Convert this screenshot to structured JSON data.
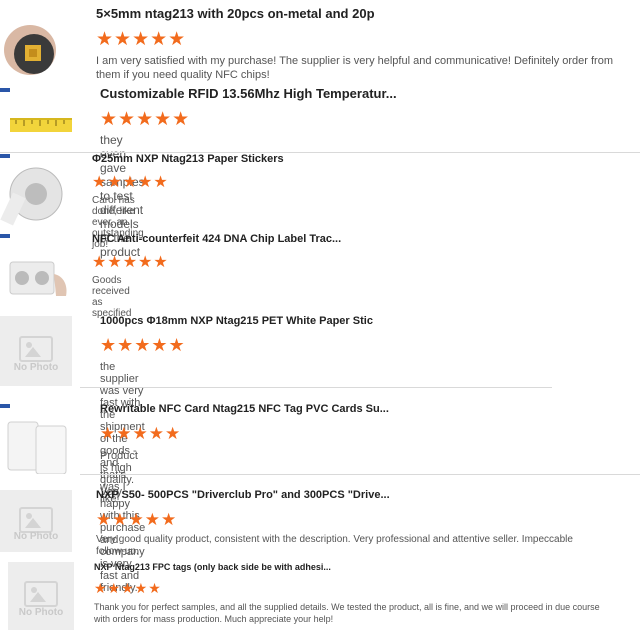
{
  "stars_glyph": "★★★★★",
  "accent_color": "#f26b1d",
  "no_photo_label": "No Photo",
  "items": [
    {
      "title": "5×5mm ntag213 with 20pcs on-metal and 20p",
      "review": "I am very satisfied with my purchase! The supplier is very helpful and communicative! Definitely order from them if you need quality NFC chips!",
      "rating": 5
    },
    {
      "title": "Customizable RFID 13.56Mhz High Temperatur...",
      "review": "they even gave samples to test different models of the product",
      "rating": 5
    },
    {
      "title": "Φ25mm NXP Ntag213 Paper Stickers",
      "review": "Carol has done, like ever,  an outstanding job!",
      "rating": 5
    },
    {
      "title": "NFC Anti-counterfeit 424 DNA Chip Label Trac...",
      "review": "Goods received as specified",
      "rating": 5
    },
    {
      "title": "1000pcs Φ18mm NXP Ntag215 PET White Paper Stic",
      "review": "the supplier was very fast with the shipment of the goods - and that's was I like!",
      "rating": 5
    },
    {
      "title": "Rewritable NFC Card Ntag215 NFC Tag PVC Cards Su...",
      "review": "Product is high quality. Very happy with this purchase and company is very fast and friendly.",
      "rating": 5
    },
    {
      "title": "NXP S50- 500PCS \"Driverclub Pro\" and 300PCS \"Drive...",
      "review": "Very good quality product, consistent with the description. Very professional and attentive seller. Impeccable follow-up.",
      "rating": 5
    },
    {
      "title": "NXP Ntag213 FPC tags (only back side be with adhesi...",
      "review": "Thank you for perfect samples, and all the supplied details. We tested the product, all is fine, and we will proceed in due course with orders for mass production. Much appreciate your help!",
      "rating": 5
    }
  ]
}
